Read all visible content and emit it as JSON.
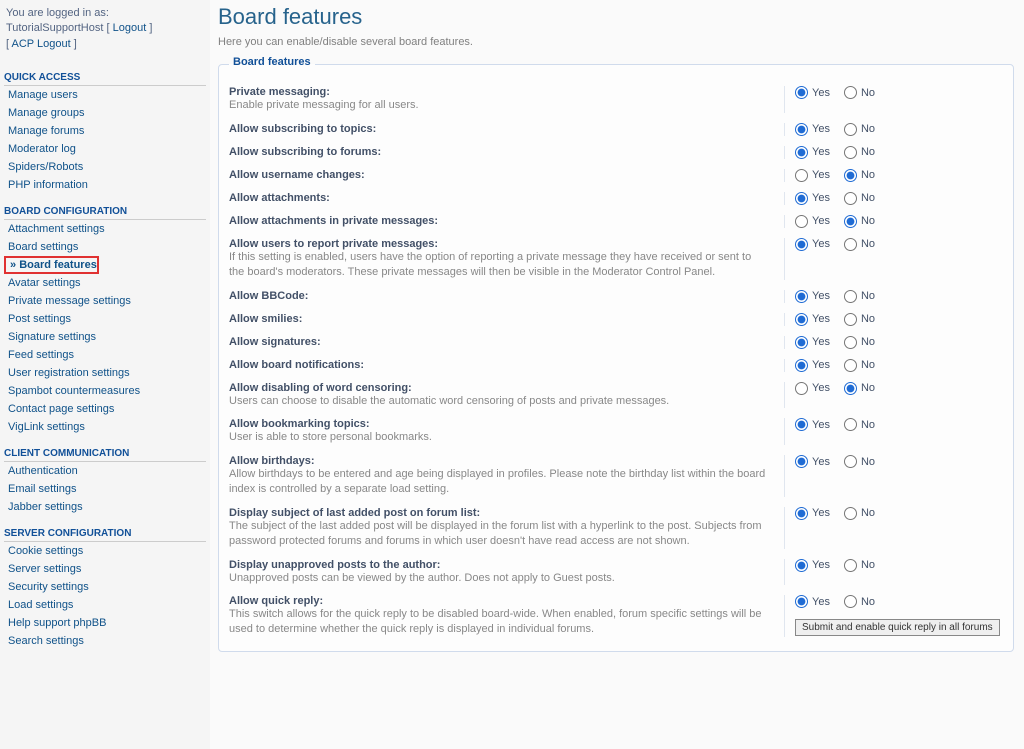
{
  "login": {
    "logged_in_as": "You are logged in as:",
    "user": "TutorialSupportHost",
    "logout": "Logout",
    "acp_logout": "ACP Logout"
  },
  "side": {
    "quick_access": {
      "heading": "QUICK ACCESS",
      "items": [
        "Manage users",
        "Manage groups",
        "Manage forums",
        "Moderator log",
        "Spiders/Robots",
        "PHP information"
      ]
    },
    "board_config": {
      "heading": "BOARD CONFIGURATION",
      "items": [
        "Attachment settings",
        "Board settings",
        "Board features",
        "Avatar settings",
        "Private message settings",
        "Post settings",
        "Signature settings",
        "Feed settings",
        "User registration settings",
        "Spambot countermeasures",
        "Contact page settings",
        "VigLink settings"
      ],
      "active_index": 2
    },
    "client_comm": {
      "heading": "CLIENT COMMUNICATION",
      "items": [
        "Authentication",
        "Email settings",
        "Jabber settings"
      ]
    },
    "server_config": {
      "heading": "SERVER CONFIGURATION",
      "items": [
        "Cookie settings",
        "Server settings",
        "Security settings",
        "Load settings",
        "Help support phpBB",
        "Search settings"
      ]
    }
  },
  "page": {
    "title": "Board features",
    "subtitle": "Here you can enable/disable several board features.",
    "legend": "Board features",
    "yes": "Yes",
    "no": "No",
    "settings": [
      {
        "title": "Private messaging:",
        "desc": "Enable private messaging for all users.",
        "val": "yes"
      },
      {
        "title": "Allow subscribing to topics:",
        "desc": "",
        "val": "yes"
      },
      {
        "title": "Allow subscribing to forums:",
        "desc": "",
        "val": "yes"
      },
      {
        "title": "Allow username changes:",
        "desc": "",
        "val": "no"
      },
      {
        "title": "Allow attachments:",
        "desc": "",
        "val": "yes"
      },
      {
        "title": "Allow attachments in private messages:",
        "desc": "",
        "val": "no"
      },
      {
        "title": "Allow users to report private messages:",
        "desc": "If this setting is enabled, users have the option of reporting a private message they have received or sent to the board's moderators. These private messages will then be visible in the Moderator Control Panel.",
        "val": "yes"
      },
      {
        "title": "Allow BBCode:",
        "desc": "",
        "val": "yes"
      },
      {
        "title": "Allow smilies:",
        "desc": "",
        "val": "yes"
      },
      {
        "title": "Allow signatures:",
        "desc": "",
        "val": "yes"
      },
      {
        "title": "Allow board notifications:",
        "desc": "",
        "val": "yes"
      },
      {
        "title": "Allow disabling of word censoring:",
        "desc": "Users can choose to disable the automatic word censoring of posts and private messages.",
        "val": "no"
      },
      {
        "title": "Allow bookmarking topics:",
        "desc": "User is able to store personal bookmarks.",
        "val": "yes"
      },
      {
        "title": "Allow birthdays:",
        "desc": "Allow birthdays to be entered and age being displayed in profiles. Please note the birthday list within the board index is controlled by a separate load setting.",
        "val": "yes"
      },
      {
        "title": "Display subject of last added post on forum list:",
        "desc": "The subject of the last added post will be displayed in the forum list with a hyperlink to the post. Subjects from password protected forums and forums in which user doesn't have read access are not shown.",
        "val": "yes"
      },
      {
        "title": "Display unapproved posts to the author:",
        "desc": "Unapproved posts can be viewed by the author. Does not apply to Guest posts.",
        "val": "yes"
      },
      {
        "title": "Allow quick reply:",
        "desc": "This switch allows for the quick reply to be disabled board-wide. When enabled, forum specific settings will be used to determine whether the quick reply is displayed in individual forums.",
        "val": "yes",
        "extra_button": "Submit and enable quick reply in all forums"
      }
    ]
  }
}
